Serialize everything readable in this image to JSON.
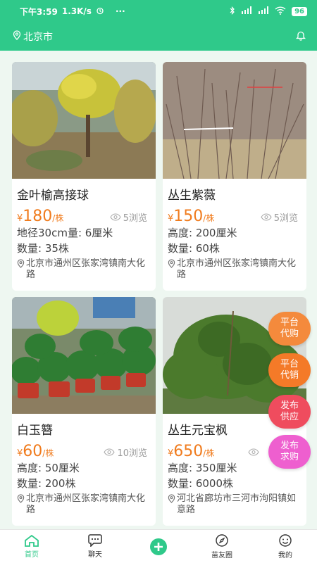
{
  "status_bar": {
    "time": "下午3:59",
    "speed": "1.3K/s",
    "battery": "96"
  },
  "header": {
    "location": "北京市"
  },
  "listings": [
    {
      "name": "金叶榆高接球",
      "price": "180",
      "unit": "/株",
      "views": "5浏览",
      "spec1": "地径30cm量: 6厘米",
      "spec2": "数量: 35株",
      "address": "北京市通州区张家湾镇南大化路"
    },
    {
      "name": "丛生紫薇",
      "price": "150",
      "unit": "/株",
      "views": "5浏览",
      "spec1": "高度: 200厘米",
      "spec2": "数量: 60株",
      "address": "北京市通州区张家湾镇南大化路"
    },
    {
      "name": "白玉簪",
      "price": "60",
      "unit": "/株",
      "views": "10浏览",
      "spec1": "高度: 50厘米",
      "spec2": "数量: 200株",
      "address": "北京市通州区张家湾镇南大化路"
    },
    {
      "name": "丛生元宝枫",
      "price": "650",
      "unit": "/株",
      "views": "",
      "spec1": "高度: 350厘米",
      "spec2": "数量: 6000株",
      "address": "河北省廊坊市三河市泃阳镇如意路"
    }
  ],
  "yen_symbol": "¥",
  "fabs": [
    {
      "label": "平台代购",
      "color": "#f48a3c"
    },
    {
      "label": "平台代销",
      "color": "#f47a28"
    },
    {
      "label": "发布供应",
      "color": "#ef4c5e"
    },
    {
      "label": "发布求购",
      "color": "#ee5fcf"
    }
  ],
  "tabs": [
    {
      "label": "首页",
      "icon": "home-icon"
    },
    {
      "label": "聊天",
      "icon": "chat-icon"
    },
    {
      "label": "",
      "icon": "add-icon"
    },
    {
      "label": "苗友圈",
      "icon": "compass-icon"
    },
    {
      "label": "我的",
      "icon": "smile-icon"
    }
  ],
  "colors": {
    "primary": "#2fc98a",
    "price": "#f07b1d"
  }
}
